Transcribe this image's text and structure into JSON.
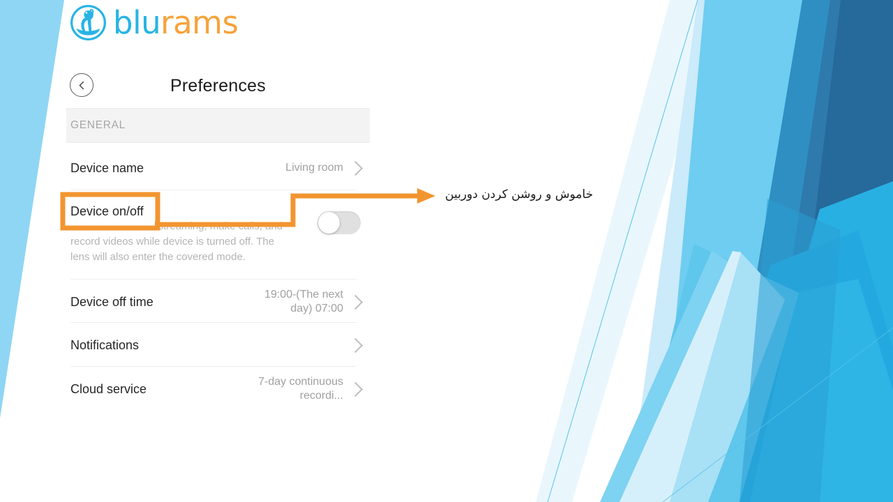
{
  "brand": {
    "name_part1": "blu",
    "name_part2": "rams",
    "logo_icon": "ram-circle-logo",
    "blue": "#28b4e4",
    "orange": "#f7a23b"
  },
  "screenshot": {
    "back_icon": "chevron-left-icon",
    "title": "Preferences",
    "section_header": "GENERAL",
    "rows": [
      {
        "label": "Device name",
        "value": "Living room",
        "chevron": "chevron-right-icon",
        "control": "chevron"
      },
      {
        "label": "Device on/off",
        "description": "You can't view live streaming, make calls, and record videos while device is turned off. The lens will also enter the covered mode.",
        "control": "toggle",
        "toggle_state": "off"
      },
      {
        "label": "Device off time",
        "value": "19:00-(The next day) 07:00",
        "chevron": "chevron-right-icon",
        "control": "chevron"
      },
      {
        "label": "Notifications",
        "value": "",
        "chevron": "chevron-right-icon",
        "control": "chevron"
      },
      {
        "label": "Cloud service",
        "value": "7-day continuous recordi...",
        "chevron": "chevron-right-icon",
        "control": "chevron"
      }
    ]
  },
  "annotation": {
    "highlight_label": "Device on/off",
    "note_text": "خاموش و روشن کردن دوربین",
    "arrow_icon": "arrow-right-icon",
    "color": "#f29530"
  },
  "background": {
    "style": "powerpoint-facet-blue",
    "colors": {
      "pale_blue": "#8fd6f4",
      "sky": "#5ec8ee",
      "light_sky": "#7ed2f2",
      "very_light": "#cfeefb",
      "mid_blue": "#30b3e4",
      "steel": "#2e7aad",
      "deep": "#236d9f",
      "hairline": "#59c2e8"
    }
  }
}
